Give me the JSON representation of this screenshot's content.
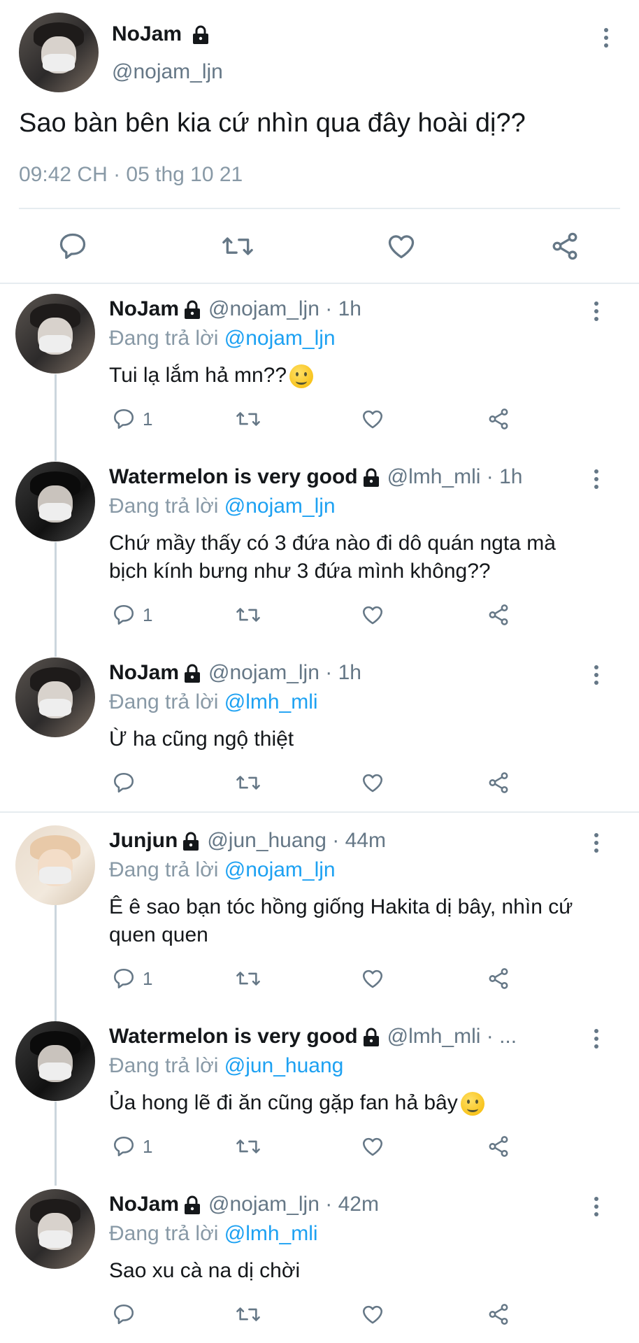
{
  "main_tweet": {
    "name": "NoJam",
    "handle": "@nojam_ljn",
    "text": "Sao bàn bên kia cứ nhìn qua đây hoài dị??",
    "timestamp": "09:42 CH · 05 thg 10 21"
  },
  "replies": [
    {
      "name": "NoJam",
      "handle": "@nojam_ljn · 1h",
      "replying_prefix": "Đang trả lời ",
      "replying_to": "@nojam_ljn",
      "text": "Tui lạ lắm hả mn??",
      "reply_count": "1"
    },
    {
      "name": "Watermelon is very good",
      "handle": "@lmh_mli · 1h",
      "replying_prefix": "Đang trả lời ",
      "replying_to": "@nojam_ljn",
      "text": "Chứ mầy thấy có 3 đứa nào đi dô quán ngta mà bịch kính bưng như 3 đứa mình không??",
      "reply_count": "1"
    },
    {
      "name": "NoJam",
      "handle": "@nojam_ljn · 1h",
      "replying_prefix": "Đang trả lời ",
      "replying_to": "@lmh_mli",
      "text": "Ừ ha cũng ngộ thiệt",
      "reply_count": ""
    },
    {
      "name": "Junjun",
      "handle": "@jun_huang · 44m",
      "replying_prefix": "Đang trả lời ",
      "replying_to": "@nojam_ljn",
      "text": "Ê ê sao bạn tóc hồng giống Hakita dị bây, nhìn cứ quen quen",
      "reply_count": "1"
    },
    {
      "name": "Watermelon is very good",
      "handle": "@lmh_mli · ...",
      "replying_prefix": "Đang trả lời ",
      "replying_to": "@jun_huang",
      "text": "Ủa hong lẽ đi ăn cũng gặp fan hả bây",
      "reply_count": "1"
    },
    {
      "name": "NoJam",
      "handle": "@nojam_ljn · 42m",
      "replying_prefix": "Đang trả lời ",
      "replying_to": "@lmh_mli",
      "text": "Sao xu cà na dị chời",
      "reply_count": ""
    }
  ],
  "icons": {
    "reply": "reply-icon",
    "retweet": "retweet-icon",
    "like": "like-icon",
    "share": "share-icon",
    "more": "more-icon",
    "lock": "lock-icon"
  },
  "colors": {
    "link": "#1da1f2",
    "secondary": "#657786",
    "divider": "#e6ecf0"
  }
}
